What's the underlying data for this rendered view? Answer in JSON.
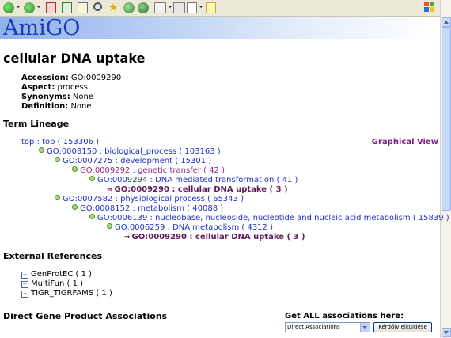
{
  "colors": {
    "link_blue": "#1f32c8",
    "link_purple": "#8e2a86",
    "current_term": "#5f1b5a",
    "logo_blue": "#1c39b6",
    "node_dot_green": "#a6db7c"
  },
  "toolbar": {
    "icons": [
      "back-icon",
      "forward-icon",
      "stop-icon",
      "refresh-icon",
      "home-icon",
      "search-icon",
      "favorites-icon",
      "media-icon",
      "history-icon",
      "mail-icon",
      "print-icon",
      "edit-icon",
      "discuss-icon",
      "windows-logo-icon"
    ]
  },
  "header": {
    "logo": "AmiGO"
  },
  "term": {
    "title": "cellular DNA uptake",
    "fields": [
      {
        "label": "Accession:",
        "value": "GO:0009290"
      },
      {
        "label": "Aspect:",
        "value": "process"
      },
      {
        "label": "Synonyms:",
        "value": "None"
      },
      {
        "label": "Definition:",
        "value": "None"
      }
    ]
  },
  "lineage": {
    "heading": "Term Lineage",
    "graphical_view": "Graphical View",
    "nodes": [
      {
        "text": "top : top ( 153306 )"
      },
      {
        "text": "GO:0008150 : biological_process ( 103163 )"
      },
      {
        "text": "GO:0007275 : development ( 15301 )"
      },
      {
        "text": "GO:0009292 : genetic transfer ( 42 )"
      },
      {
        "text": "GO:0009294 : DNA mediated transformation ( 41 )"
      },
      {
        "text": "GO:0009290 : cellular DNA uptake ( 3 )"
      },
      {
        "text": "GO:0007582 : physiological process ( 65343 )"
      },
      {
        "text": "GO:0008152 : metabolism ( 40088 )"
      },
      {
        "text": "GO:0006139 : nucleobase, nucleoside, nucleotide and nucleic acid metabolism ( 15839 )"
      },
      {
        "text": "GO:0006259 : DNA metabolism ( 4312 )"
      },
      {
        "text": "GO:0009290 : cellular DNA uptake ( 3 )"
      }
    ]
  },
  "external": {
    "heading": "External References",
    "items": [
      {
        "label": "GenProtEC ( 1 )"
      },
      {
        "label": "MultiFun ( 1 )"
      },
      {
        "label": "TIGR_TIGRFAMS ( 1 )"
      }
    ]
  },
  "associations": {
    "heading": "Direct Gene Product Associations",
    "get_all": "Get ALL associations here:",
    "select_value": "Direct Associations",
    "submit_label": "Kérdőív elküldése"
  }
}
